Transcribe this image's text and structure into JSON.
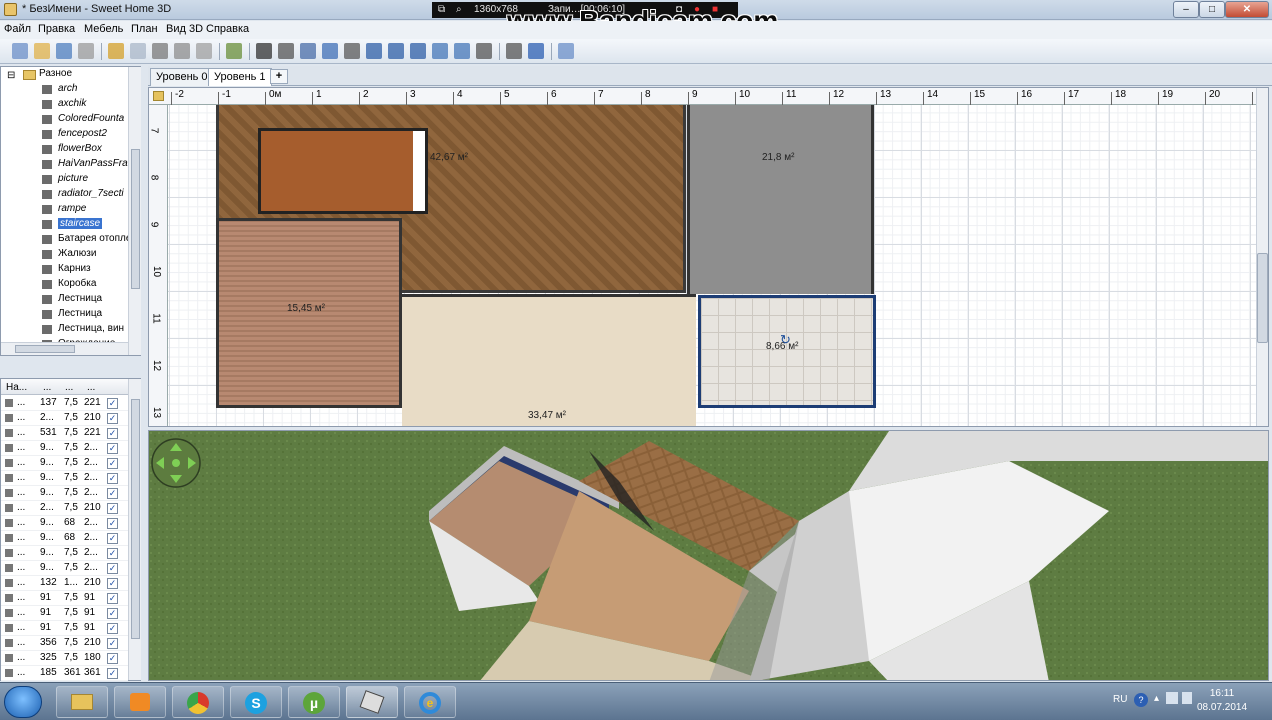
{
  "window": {
    "title": "* БезИмени - Sweet Home 3D",
    "min": "–",
    "max": "□",
    "close": "✕"
  },
  "recorder": {
    "resolution": "1360x768",
    "status": "Запи…[00:06:10]",
    "watermark": "www.Bandicam.com"
  },
  "menu": [
    "Файл",
    "Правка",
    "Мебель",
    "План",
    "Вид 3D",
    "Справка"
  ],
  "toolbar": {
    "groups": [
      [
        "new-icon",
        "open-icon",
        "save-icon",
        "cut-tool-icon"
      ],
      [
        "undo-icon",
        "redo-icon",
        "cut-icon",
        "copy-icon",
        "paste-icon"
      ],
      [
        "add-furniture-icon"
      ],
      [
        "select-icon",
        "pan-icon",
        "create-walls-icon",
        "create-rooms-icon",
        "create-dimensions-icon",
        "add-text-icon",
        "text-style-a-icon",
        "text-style-b-icon",
        "text-style-c-icon",
        "zoom-in-icon",
        "zoom-out-icon"
      ],
      [
        "photo-icon",
        "video-icon"
      ],
      [
        "help-icon"
      ]
    ]
  },
  "catalog": {
    "folder": "Разное",
    "items": [
      {
        "label": "arch",
        "italic": true
      },
      {
        "label": "axchik",
        "italic": true
      },
      {
        "label": "ColoredFounta",
        "italic": true
      },
      {
        "label": "fencepost2",
        "italic": true
      },
      {
        "label": "flowerBox",
        "italic": true
      },
      {
        "label": "HaiVanPassFra",
        "italic": true
      },
      {
        "label": "picture",
        "italic": true
      },
      {
        "label": "radiator_7secti",
        "italic": true
      },
      {
        "label": "rampe",
        "italic": true
      },
      {
        "label": "staircase",
        "italic": true,
        "selected": true
      },
      {
        "label": "Батарея отопле",
        "italic": false
      },
      {
        "label": "Жалюзи",
        "italic": false
      },
      {
        "label": "Карниз",
        "italic": false
      },
      {
        "label": "Коробка",
        "italic": false
      },
      {
        "label": "Лестница",
        "italic": false
      },
      {
        "label": "Лестница",
        "italic": false
      },
      {
        "label": "Лестница, вин",
        "italic": false
      },
      {
        "label": "Ограждение",
        "italic": false
      }
    ]
  },
  "furniture_table": {
    "headers": [
      "На...",
      "...",
      "...",
      "..."
    ],
    "rows": [
      [
        "...",
        "137",
        "7,5",
        "221"
      ],
      [
        "...",
        "2...",
        "7,5",
        "210"
      ],
      [
        "...",
        "531",
        "7,5",
        "221"
      ],
      [
        "...",
        "9...",
        "7,5",
        "2..."
      ],
      [
        "...",
        "9...",
        "7,5",
        "2..."
      ],
      [
        "...",
        "9...",
        "7,5",
        "2..."
      ],
      [
        "...",
        "9...",
        "7,5",
        "2..."
      ],
      [
        "...",
        "2...",
        "7,5",
        "210"
      ],
      [
        "...",
        "9...",
        "68",
        "2..."
      ],
      [
        "...",
        "9...",
        "68",
        "2..."
      ],
      [
        "...",
        "9...",
        "7,5",
        "2..."
      ],
      [
        "...",
        "9...",
        "7,5",
        "2..."
      ],
      [
        "...",
        "132",
        "1...",
        "210"
      ],
      [
        "...",
        "91",
        "7,5",
        "91"
      ],
      [
        "...",
        "91",
        "7,5",
        "91"
      ],
      [
        "...",
        "91",
        "7,5",
        "91"
      ],
      [
        "...",
        "356",
        "7,5",
        "210"
      ],
      [
        "...",
        "325",
        "7,5",
        "180"
      ],
      [
        "...",
        "185",
        "361",
        "361"
      ]
    ],
    "check": "✓"
  },
  "tabs": {
    "level0": "Уровень 0",
    "level1": "Уровень 1",
    "add": "+"
  },
  "plan": {
    "ruler_x": [
      "-2",
      "-1",
      "0м",
      "1",
      "2",
      "3",
      "4",
      "5",
      "6",
      "7",
      "8",
      "9",
      "10",
      "11",
      "12",
      "13",
      "14",
      "15",
      "16",
      "17",
      "18",
      "19",
      "20",
      "2"
    ],
    "ruler_y": [
      "7",
      "8",
      "9",
      "10",
      "11",
      "12",
      "13"
    ],
    "rooms": {
      "hall": "42,67 м²",
      "grey": "21,8 м²",
      "left": "15,45 м²",
      "bath": "8,66 м²",
      "bottom": "33,47 м²"
    }
  },
  "taskbar": {
    "lang": "RU",
    "time": "16:11",
    "date": "08.07.2014"
  }
}
